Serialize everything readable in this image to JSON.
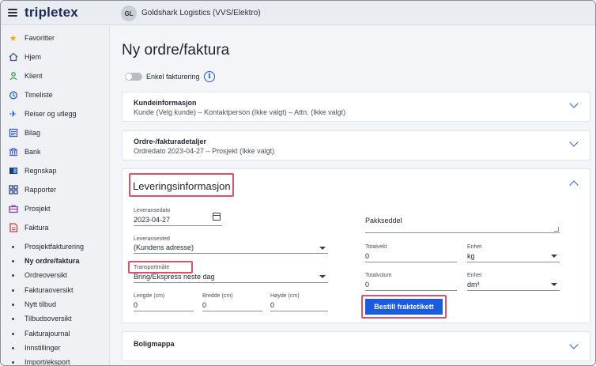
{
  "app": {
    "logo": "tripletex",
    "company_initials": "GL",
    "company_name": "Goldshark Logistics (VVS/Elektro)"
  },
  "sidebar": {
    "items": [
      {
        "label": "Favoritter",
        "icon": "star-icon"
      },
      {
        "label": "Hjem",
        "icon": "home-icon"
      },
      {
        "label": "Klient",
        "icon": "client-icon"
      },
      {
        "label": "Timeliste",
        "icon": "timer-icon"
      },
      {
        "label": "Reiser og utlegg",
        "icon": "plane-icon"
      },
      {
        "label": "Bilag",
        "icon": "voucher-icon"
      },
      {
        "label": "Bank",
        "icon": "bank-icon"
      },
      {
        "label": "Regnskap",
        "icon": "book-icon"
      },
      {
        "label": "Rapporter",
        "icon": "dashboard-icon"
      },
      {
        "label": "Prosjekt",
        "icon": "briefcase-icon"
      },
      {
        "label": "Faktura",
        "icon": "invoice-icon"
      }
    ],
    "subitems": [
      {
        "label": "Prosjektfakturering"
      },
      {
        "label": "Ny ordre/faktura",
        "active": true
      },
      {
        "label": "Ordreoversikt"
      },
      {
        "label": "Fakturaoversikt"
      },
      {
        "label": "Nytt tilbud"
      },
      {
        "label": "Tilbudsoversikt"
      },
      {
        "label": "Fakturajournal"
      },
      {
        "label": "Innstillinger"
      },
      {
        "label": "Import/eksport"
      }
    ]
  },
  "main": {
    "title": "Ny ordre/faktura",
    "toggle_label": "Enkel fakturering",
    "customer": {
      "title": "Kundeinformasjon",
      "summary": "Kunde (Velg kunde)  –  Kontaktperson (Ikke valgt)  –  Attn. (Ikke valgt)"
    },
    "order": {
      "title": "Ordre-/fakturadetaljer",
      "summary": "Ordredato 2023-04-27  –  Prosjekt (Ikke valgt)"
    },
    "delivery": {
      "title": "Leveringsinformasjon",
      "date_label": "Leveransedato",
      "date_value": "2023-04-27",
      "place_label": "Leveransested",
      "place_value": "(Kundens adresse)",
      "transport_label": "Transportmåte",
      "transport_value": "Bring/Ekspress neste dag",
      "length_label": "Lengde (cm)",
      "length_value": "0",
      "width_label": "Bredde (cm)",
      "width_value": "0",
      "height_label": "Høyde (cm)",
      "height_value": "0",
      "packing_label": "Pakkseddel",
      "weight_label": "Totalvekt",
      "weight_value": "0",
      "weight_unit_label": "Enhet",
      "weight_unit_value": "kg",
      "volume_label": "Totalvolum",
      "volume_value": "0",
      "volume_unit_label": "Enhet",
      "volume_unit_value": "dm³",
      "order_button": "Bestill fraktetikett"
    },
    "housing": {
      "title": "Boligmappa"
    }
  },
  "colors": {
    "accent": "#1a5be0",
    "highlight": "#d8546c"
  }
}
